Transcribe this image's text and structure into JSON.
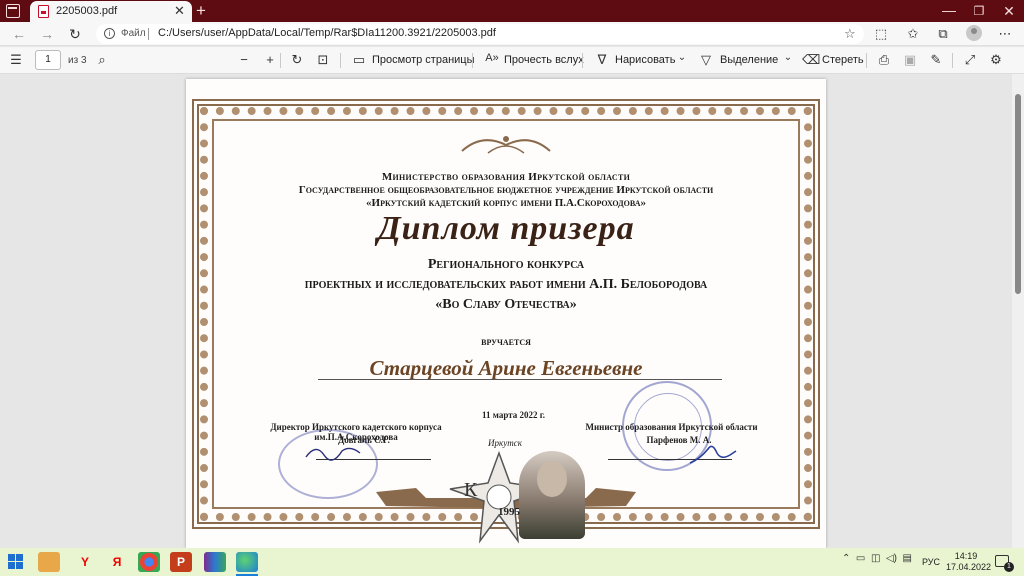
{
  "browser": {
    "tab_title": "2205003.pdf",
    "tab_close": "✕",
    "new_tab": "+",
    "min": "—",
    "max": "❐",
    "close": "✕",
    "url_label": "Файл",
    "url": "C:/Users/user/AppData/Local/Temp/Rar$DIa11200.3921/2205003.pdf"
  },
  "pdf_toolbar": {
    "page_current": "1",
    "page_of": "из 3",
    "view_mode": "Просмотр страницы",
    "read_aloud": "Прочесть вслух",
    "draw": "Нарисовать",
    "highlight": "Выделение",
    "erase": "Стереть"
  },
  "diploma": {
    "ministry": "Министерство образования Иркутской области",
    "institution": "Государственное общеобразовательное бюджетное учреждение Иркутской области",
    "corps": "«Иркутский кадетский корпус имени П.А.Скороходова»",
    "title": "Диплом призера",
    "contest_1": "Регионального конкурса",
    "contest_2": "проектных и исследовательских работ имени А.П. Белобородова",
    "contest_3": "«Во Славу Отечества»",
    "awarded": "вручается",
    "recipient": "Старцевой Арине Евгеньевне",
    "date": "11 марта 2022 г.",
    "director_title": "Директор Иркутского кадетского корпуса им.П.А.Скороходова",
    "director_name": "Довгаль С.Г.",
    "minister_title": "Министр образования Иркутской области",
    "minister_name": "Парфенов М. А.",
    "emblem_city": "Иркутск",
    "emblem_letter": "К",
    "emblem_year": "1995"
  },
  "taskbar": {
    "lang": "РУС",
    "time": "14:19",
    "date": "17.04.2022",
    "notif_count": "1",
    "yandex_label": "Я"
  },
  "colors": {
    "titlebar": "#5e0b12",
    "taskbar": "#e9f5d0",
    "frame": "#8a6a4d"
  }
}
